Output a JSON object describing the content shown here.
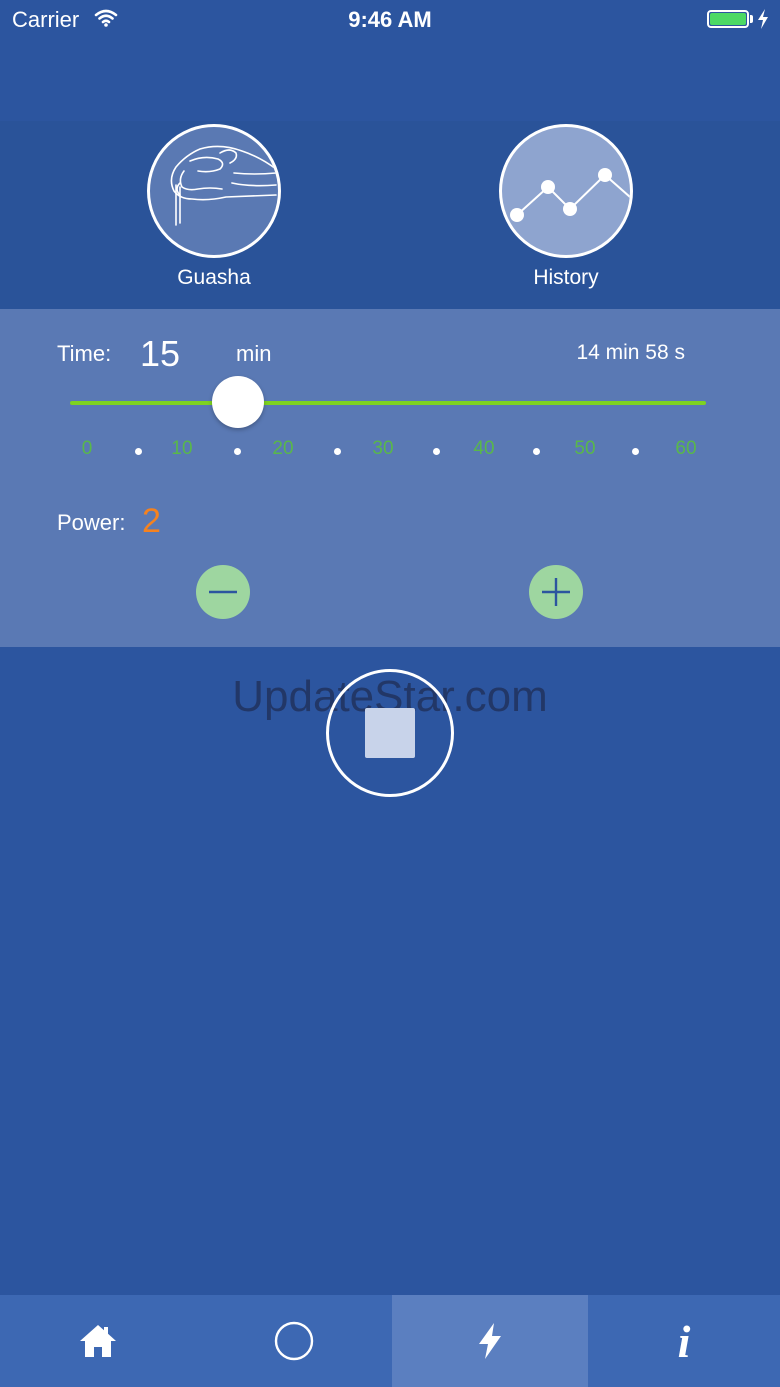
{
  "status_bar": {
    "carrier": "Carrier",
    "time": "9:46 AM",
    "icons": [
      "wifi-icon",
      "battery-icon",
      "charging-bolt-icon"
    ],
    "battery_color": "#4cd964"
  },
  "shortcuts": [
    {
      "label": "Guasha",
      "icon": "hand-icon"
    },
    {
      "label": "History",
      "icon": "line-chart-icon"
    }
  ],
  "timer": {
    "label": "Time:",
    "value": "15",
    "unit": "min",
    "remaining": "14 min 58 s",
    "slider_value": 15,
    "slider_max": 60,
    "ticks": [
      "0",
      "10",
      "20",
      "30",
      "40",
      "50",
      "60"
    ],
    "track_color": "#7ed321",
    "tick_color": "#59b84a"
  },
  "power": {
    "label": "Power:",
    "value": "2",
    "value_color": "#f5821f",
    "decrease_icon": "minus-icon",
    "increase_icon": "plus-icon",
    "button_color": "#9ed6a0"
  },
  "watermark": "UpdateStar.com",
  "control": {
    "icon": "stop-icon"
  },
  "tabs": [
    {
      "icon": "home-icon",
      "selected": false
    },
    {
      "icon": "circle-icon",
      "selected": false
    },
    {
      "icon": "bolt-icon",
      "selected": true
    },
    {
      "icon": "info-icon",
      "selected": false
    }
  ],
  "colors": {
    "background": "#2c559f",
    "settings_panel": "#5a79b4",
    "tabbar": "#3d68b3",
    "tab_selected": "#5b7fc0"
  }
}
